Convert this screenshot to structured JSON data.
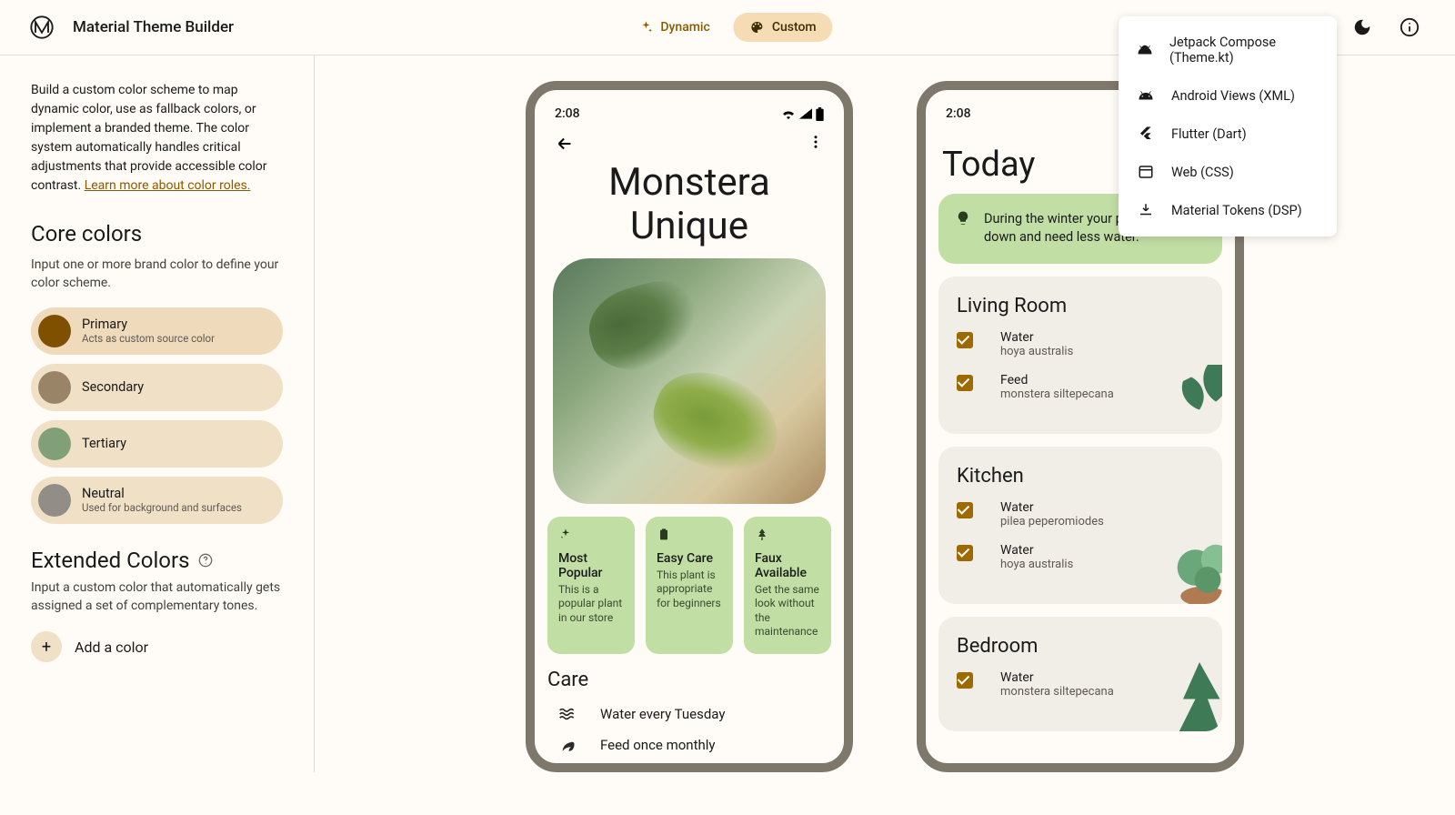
{
  "header": {
    "app_title": "Material Theme Builder",
    "dynamic_label": "Dynamic",
    "custom_label": "Custom"
  },
  "export_menu": [
    {
      "label": "Jetpack Compose (Theme.kt)",
      "icon": "android"
    },
    {
      "label": "Android Views (XML)",
      "icon": "android"
    },
    {
      "label": "Flutter (Dart)",
      "icon": "flutter"
    },
    {
      "label": "Web (CSS)",
      "icon": "web"
    },
    {
      "label": "Material Tokens (DSP)",
      "icon": "download"
    }
  ],
  "sidebar": {
    "description": "Build a custom color scheme to map dynamic color, use as fallback colors, or implement a branded theme. The color system automatically handles critical adjustments that provide accessible color contrast. ",
    "learn_more": "Learn more about color roles.",
    "core_title": "Core colors",
    "core_sub": "Input one or more brand color to define your color scheme.",
    "colors": [
      {
        "name": "Primary",
        "sub": "Acts as custom source color",
        "hex": "#7f5000"
      },
      {
        "name": "Secondary",
        "sub": "",
        "hex": "#9a8467"
      },
      {
        "name": "Tertiary",
        "sub": "",
        "hex": "#81a07a"
      },
      {
        "name": "Neutral",
        "sub": "Used for background and surfaces",
        "hex": "#928d86"
      }
    ],
    "ext_title": "Extended Colors",
    "ext_sub": "Input a custom color that automatically gets assigned a set of complementary tones.",
    "add_color_label": "Add a color"
  },
  "phoneA": {
    "time": "2:08",
    "title_line1": "Monstera",
    "title_line2": "Unique",
    "chips": [
      {
        "title": "Most Popular",
        "sub": "This is a popular plant in our store"
      },
      {
        "title": "Easy Care",
        "sub": "This plant is appropriate for beginners"
      },
      {
        "title": "Faux Available",
        "sub": "Get the same look without the maintenance"
      }
    ],
    "care_heading": "Care",
    "care_items": [
      "Water every Tuesday",
      "Feed once monthly"
    ]
  },
  "phoneB": {
    "time": "2:08",
    "title": "Today",
    "banner": "During the winter your plants slow down and need less water.",
    "rooms": [
      {
        "name": "Living Room",
        "tasks": [
          {
            "title": "Water",
            "sub": "hoya australis"
          },
          {
            "title": "Feed",
            "sub": "monstera siltepecana"
          }
        ]
      },
      {
        "name": "Kitchen",
        "tasks": [
          {
            "title": "Water",
            "sub": "pilea peperomiodes"
          },
          {
            "title": "Water",
            "sub": "hoya australis"
          }
        ]
      },
      {
        "name": "Bedroom",
        "tasks": [
          {
            "title": "Water",
            "sub": "monstera siltepecana"
          }
        ]
      }
    ]
  }
}
